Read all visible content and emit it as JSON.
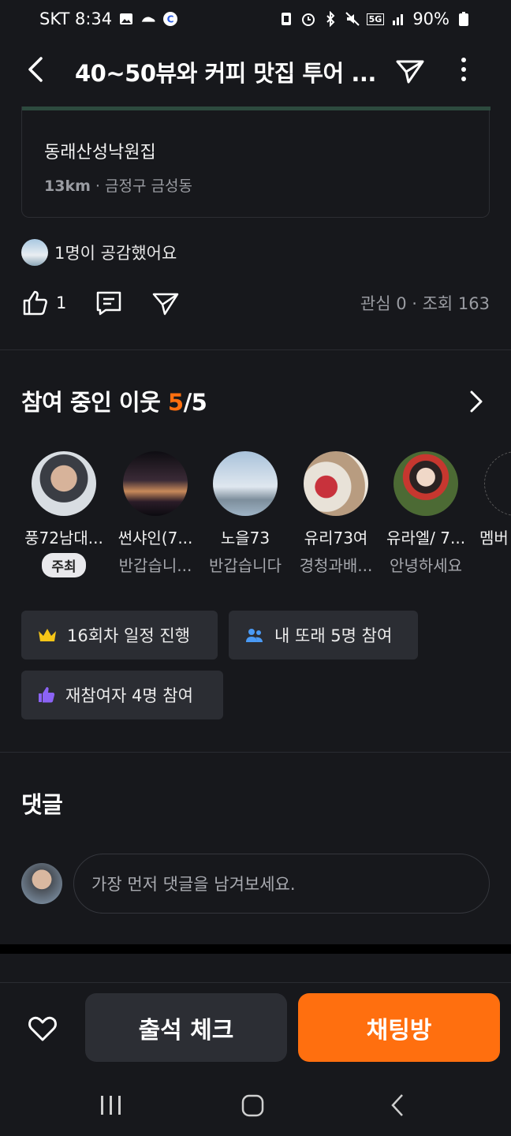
{
  "status_bar": {
    "carrier_time": "SKT 8:34",
    "network": "5G",
    "battery": "90%",
    "icons": [
      "gallery-icon",
      "cloud-icon",
      "c-app-icon",
      "nfc-icon",
      "alarm-icon",
      "bluetooth-icon",
      "mute-icon",
      "signal-icon",
      "battery-icon"
    ]
  },
  "header": {
    "title": "40~50뷰와 커피 맛집 투어 ...",
    "icons": [
      "back-icon",
      "share-icon",
      "more-icon"
    ]
  },
  "place": {
    "name": "동래산성낙원집",
    "distance": "13km",
    "address": "· 금정구 금성동"
  },
  "empathy": {
    "text": "1명이 공감했어요"
  },
  "actions": {
    "like_count": "1",
    "stats": "관심 0 · 조회 163"
  },
  "participants": {
    "title": "참여 중인 이웃",
    "current": "5",
    "total": "/5",
    "members": [
      {
        "name": "풍72남대...",
        "badge": "주최",
        "desc": ""
      },
      {
        "name": "썬샤인(7...",
        "badge": "",
        "desc": "반갑습니..."
      },
      {
        "name": "노을73",
        "badge": "",
        "desc": "반갑습니다"
      },
      {
        "name": "유리73여",
        "badge": "",
        "desc": "경청과배..."
      },
      {
        "name": "유라엘/ 7...",
        "badge": "",
        "desc": "안녕하세요"
      },
      {
        "name": "멤버",
        "badge": "",
        "desc": ""
      }
    ]
  },
  "chips": {
    "sessions": "16회차 일정 진행",
    "peers": "내 또래 5명 참여",
    "rejoin": "재참여자 4명 참여"
  },
  "comments": {
    "title": "댓글",
    "placeholder": "가장 먼저 댓글을 남겨보세요."
  },
  "bottom": {
    "attend_label": "출석 체크",
    "chat_label": "채팅방"
  },
  "colors": {
    "accent": "#ff6f0f",
    "background": "#17181c",
    "chip": "#2b2d33"
  }
}
